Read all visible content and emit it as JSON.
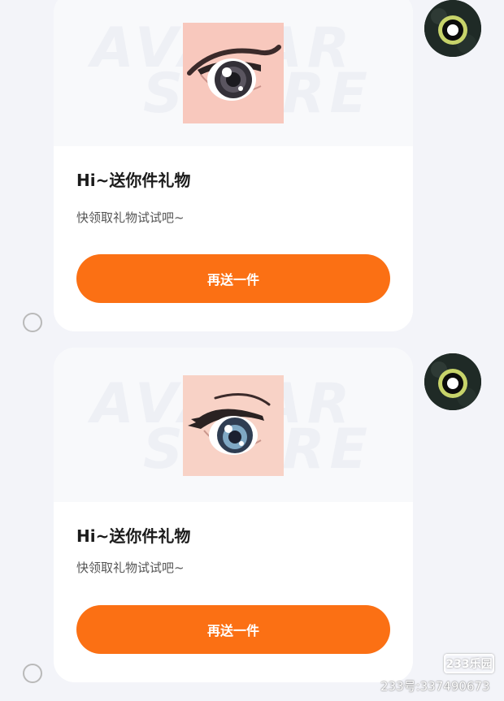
{
  "messages": [
    {
      "title": "Hi~送你件礼物",
      "subtitle": "快领取礼物试试吧~",
      "button_label": "再送一件",
      "watermark_line1": "AVATAR",
      "watermark_line2": "STORE",
      "gift_image": "anime-eye-icon",
      "avatar_image": "eye-avatar-icon",
      "selected": false
    },
    {
      "title": "Hi~送你件礼物",
      "subtitle": "快领取礼物试试吧~",
      "button_label": "再送一件",
      "watermark_line1": "AVATAR",
      "watermark_line2": "STORE",
      "gift_image": "anime-eye-icon",
      "avatar_image": "eye-avatar-icon",
      "selected": false
    }
  ],
  "site_watermark": {
    "logo_text": "233乐园",
    "id_text": "233号:337490673"
  },
  "colors": {
    "background": "#f3f4f9",
    "card": "#ffffff",
    "accent": "#fb7014",
    "gift_bg": "#f8c8bd"
  }
}
